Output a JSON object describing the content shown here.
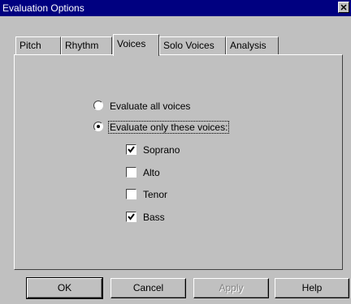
{
  "window": {
    "title": "Evaluation Options"
  },
  "icons": {
    "close": "close-icon"
  },
  "tabs": [
    {
      "label": "Pitch"
    },
    {
      "label": "Rhythm"
    },
    {
      "label": "Voices",
      "active": true
    },
    {
      "label": "Solo Voices"
    },
    {
      "label": "Analysis"
    }
  ],
  "voices": {
    "radio_all": {
      "label": "Evaluate all voices",
      "checked": false
    },
    "radio_only": {
      "label": "Evaluate only these voices:",
      "checked": true
    },
    "checkboxes": [
      {
        "label": "Soprano",
        "checked": true
      },
      {
        "label": "Alto",
        "checked": false
      },
      {
        "label": "Tenor",
        "checked": false
      },
      {
        "label": "Bass",
        "checked": true
      }
    ]
  },
  "buttons": {
    "ok": "OK",
    "cancel": "Cancel",
    "apply": "Apply",
    "help": "Help"
  }
}
